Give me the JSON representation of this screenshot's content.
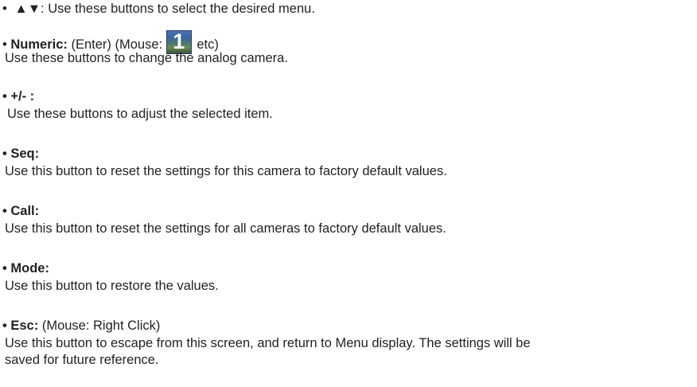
{
  "items": [
    {
      "bullet": "•",
      "arrows": "▲▼",
      "text": ": Use these buttons to select the desired menu."
    },
    {
      "bullet": "•",
      "label": "Numeric:",
      "extra_before": "(Enter) (Mouse:",
      "icon_digit": "1",
      "extra_after": "etc)",
      "description": "Use these buttons to change the analog camera."
    },
    {
      "bullet": "•",
      "label": "+/- :",
      "description": "Use these buttons to adjust the selected item."
    },
    {
      "bullet": "•",
      "label": "Seq:",
      "description": "Use this button to reset the settings for this camera to factory default values."
    },
    {
      "bullet": "•",
      "label": "Call:",
      "description": "Use this button to reset the settings for all cameras to factory default values."
    },
    {
      "bullet": "•",
      "label": "Mode:",
      "description": "Use this button to restore the values."
    },
    {
      "bullet": "•",
      "label": "Esc:",
      "extra": "(Mouse: Right Click)",
      "description": "Use this button to escape from this screen, and return to Menu display. The settings will be",
      "description_cont": "saved for future reference."
    }
  ]
}
